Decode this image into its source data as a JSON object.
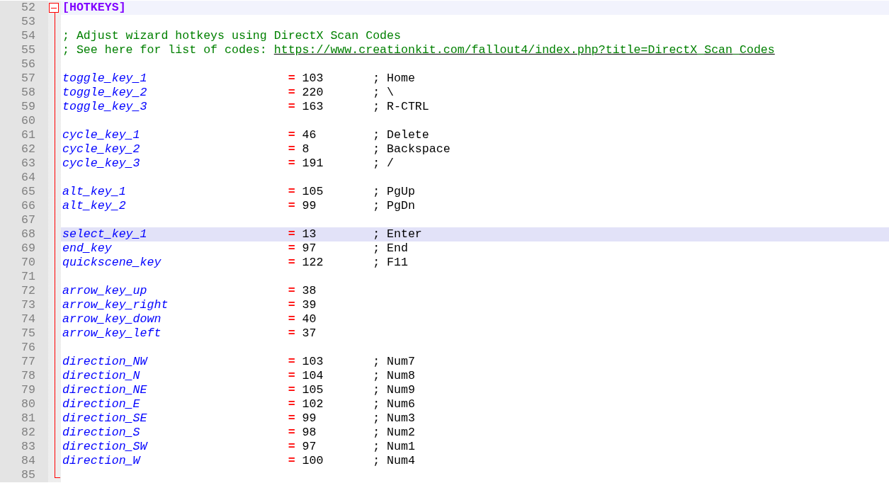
{
  "lines": [
    {
      "number": "52",
      "kind": "section",
      "text": "[HOTKEYS]",
      "selected": false
    },
    {
      "number": "53",
      "kind": "blank",
      "selected": false
    },
    {
      "number": "54",
      "kind": "comment",
      "text": "; Adjust wizard hotkeys using DirectX Scan Codes",
      "selected": false
    },
    {
      "number": "55",
      "kind": "comment",
      "text": "; See here for list of codes: ",
      "link": "https://www.creationkit.com/fallout4/index.php?title=DirectX_Scan_Codes",
      "selected": false
    },
    {
      "number": "56",
      "kind": "blank",
      "selected": false
    },
    {
      "number": "57",
      "kind": "pair",
      "key": "toggle_key_1",
      "op": "=",
      "value": "103",
      "comment": "; Home",
      "selected": false
    },
    {
      "number": "58",
      "kind": "pair",
      "key": "toggle_key_2",
      "op": "=",
      "value": "220",
      "comment": "; \\",
      "selected": false
    },
    {
      "number": "59",
      "kind": "pair",
      "key": "toggle_key_3",
      "op": "=",
      "value": "163",
      "comment": "; R-CTRL",
      "selected": false
    },
    {
      "number": "60",
      "kind": "blank",
      "selected": false
    },
    {
      "number": "61",
      "kind": "pair",
      "key": "cycle_key_1",
      "op": "=",
      "value": "46",
      "comment": "; Delete",
      "selected": false
    },
    {
      "number": "62",
      "kind": "pair",
      "key": "cycle_key_2",
      "op": "=",
      "value": "8",
      "comment": "; Backspace",
      "selected": false
    },
    {
      "number": "63",
      "kind": "pair",
      "key": "cycle_key_3",
      "op": "=",
      "value": "191",
      "comment": "; /",
      "selected": false
    },
    {
      "number": "64",
      "kind": "blank",
      "selected": false
    },
    {
      "number": "65",
      "kind": "pair",
      "key": "alt_key_1",
      "op": "=",
      "value": "105",
      "comment": "; PgUp",
      "selected": false
    },
    {
      "number": "66",
      "kind": "pair",
      "key": "alt_key_2",
      "op": "=",
      "value": "99",
      "comment": "; PgDn",
      "selected": false
    },
    {
      "number": "67",
      "kind": "blank",
      "selected": false
    },
    {
      "number": "68",
      "kind": "pair",
      "key": "select_key_1",
      "op": "=",
      "value": "13",
      "comment": "; Enter",
      "selected": true
    },
    {
      "number": "69",
      "kind": "pair",
      "key": "end_key",
      "op": "=",
      "value": "97",
      "comment": "; End",
      "selected": false
    },
    {
      "number": "70",
      "kind": "pair",
      "key": "quickscene_key",
      "op": "=",
      "value": "122",
      "comment": "; F11",
      "selected": false
    },
    {
      "number": "71",
      "kind": "blank",
      "selected": false
    },
    {
      "number": "72",
      "kind": "pair",
      "key": "arrow_key_up",
      "op": "=",
      "value": "38",
      "selected": false
    },
    {
      "number": "73",
      "kind": "pair",
      "key": "arrow_key_right",
      "op": "=",
      "value": "39",
      "selected": false
    },
    {
      "number": "74",
      "kind": "pair",
      "key": "arrow_key_down",
      "op": "=",
      "value": "40",
      "selected": false
    },
    {
      "number": "75",
      "kind": "pair",
      "key": "arrow_key_left",
      "op": "=",
      "value": "37",
      "selected": false
    },
    {
      "number": "76",
      "kind": "blank",
      "selected": false
    },
    {
      "number": "77",
      "kind": "pair",
      "key": "direction_NW",
      "op": "=",
      "value": "103",
      "comment": "; Num7",
      "selected": false
    },
    {
      "number": "78",
      "kind": "pair",
      "key": "direction_N",
      "op": "=",
      "value": "104",
      "comment": "; Num8",
      "selected": false
    },
    {
      "number": "79",
      "kind": "pair",
      "key": "direction_NE",
      "op": "=",
      "value": "105",
      "comment": "; Num9",
      "selected": false
    },
    {
      "number": "80",
      "kind": "pair",
      "key": "direction_E",
      "op": "=",
      "value": "102",
      "comment": "; Num6",
      "selected": false
    },
    {
      "number": "81",
      "kind": "pair",
      "key": "direction_SE",
      "op": "=",
      "value": "99",
      "comment": "; Num3",
      "selected": false
    },
    {
      "number": "82",
      "kind": "pair",
      "key": "direction_S",
      "op": "=",
      "value": "98",
      "comment": "; Num2",
      "selected": false
    },
    {
      "number": "83",
      "kind": "pair",
      "key": "direction_SW",
      "op": "=",
      "value": "97",
      "comment": "; Num1",
      "selected": false
    },
    {
      "number": "84",
      "kind": "pair",
      "key": "direction_W",
      "op": "=",
      "value": "100",
      "comment": "; Num4",
      "selected": false
    },
    {
      "number": "85",
      "kind": "blank",
      "selected": false
    }
  ]
}
